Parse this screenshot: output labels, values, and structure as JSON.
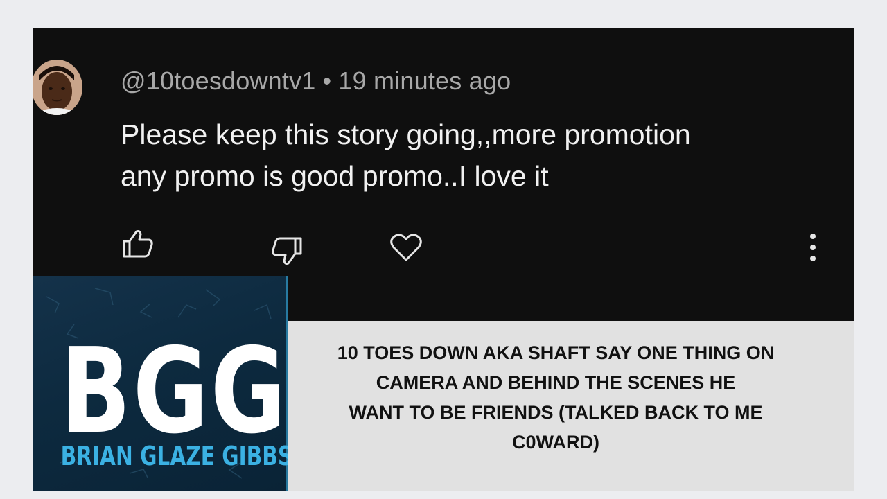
{
  "comment": {
    "author": "@10toesdowntv1",
    "separator": "•",
    "time": "19 minutes ago",
    "text_lines": [
      "Please keep this story going,,more promotion",
      "any promo is good promo..I love it"
    ],
    "actions": [
      "like-icon",
      "dislike-icon",
      "heart-icon",
      "more-options-icon"
    ]
  },
  "logo": {
    "mark": "BGG",
    "name": "BRIAN GLAZE GIBBS"
  },
  "headline": {
    "lines": [
      "10 TOES DOWN AKA SHAFT SAY ONE THING ON",
      "CAMERA AND BEHIND THE SCENES HE",
      "WANT TO BE FRIENDS (TALKED BACK TO ME",
      "C0WARD)"
    ]
  },
  "colors": {
    "page_bg": "#ecedf0",
    "comment_bg": "#0f0f0f",
    "comment_text": "#f1f1f1",
    "meta_text": "#a8a8a8",
    "logo_bg": "#0d2a3f",
    "logo_accent": "#3bb1e3",
    "caption_bg": "#e1e1e1"
  }
}
